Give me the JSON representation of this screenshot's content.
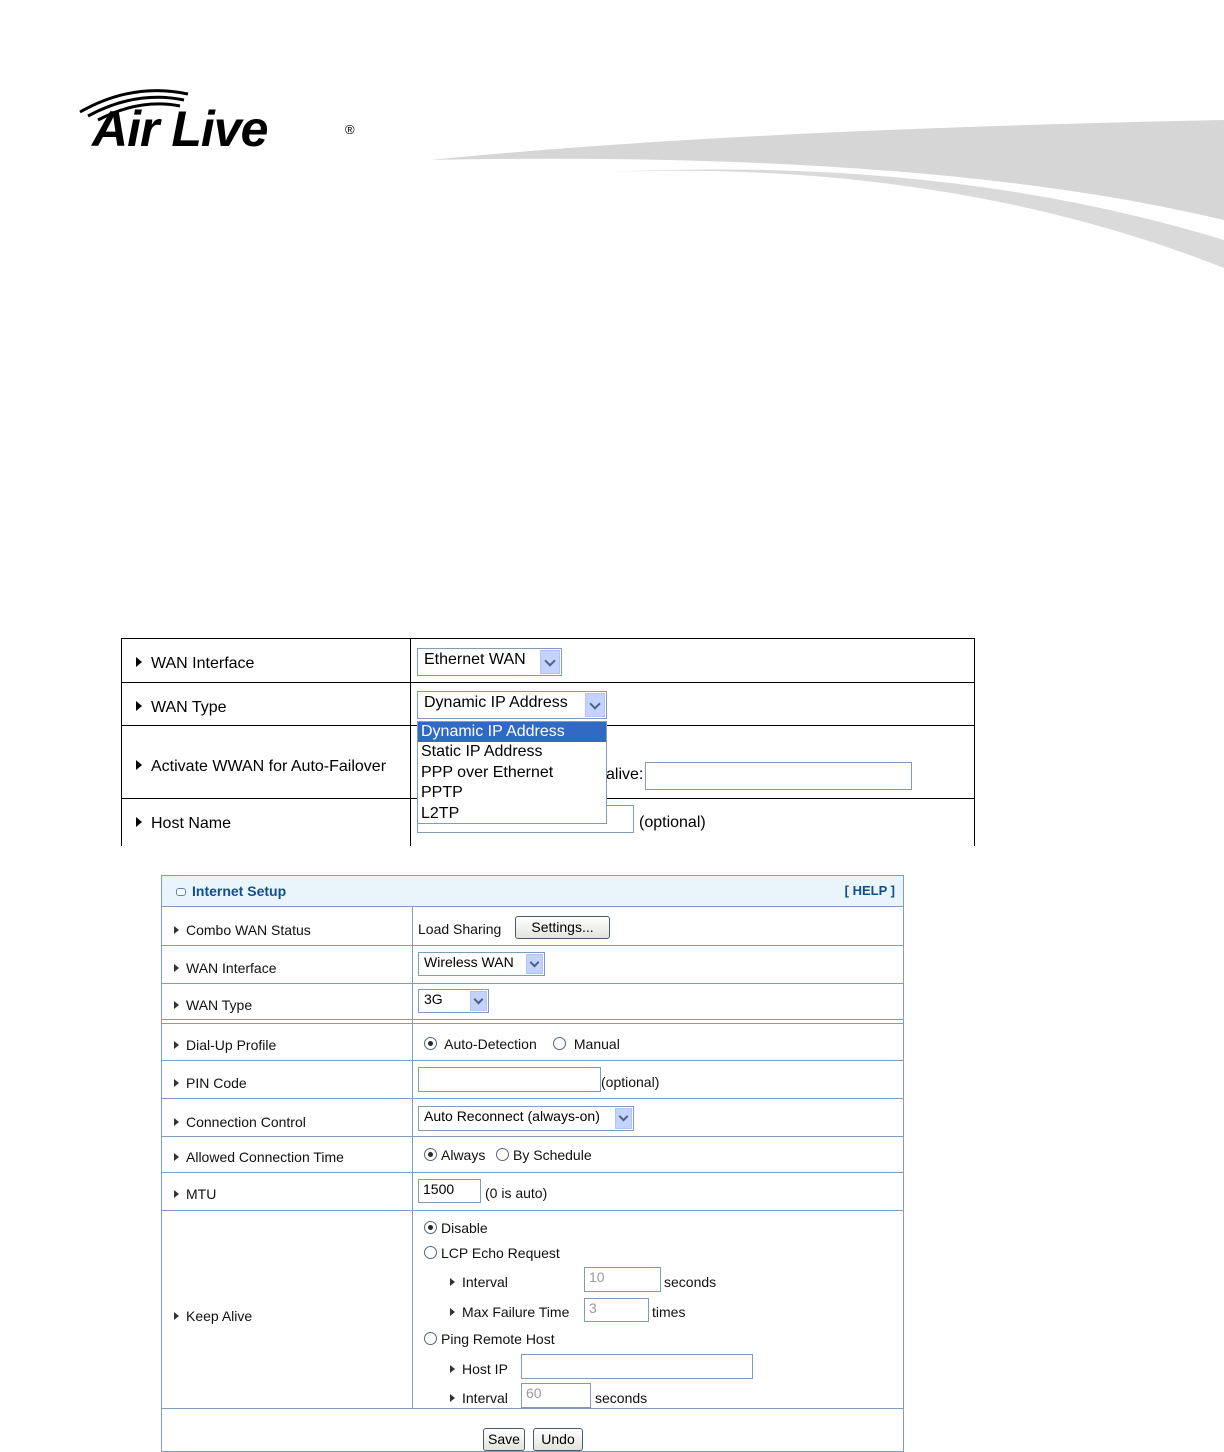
{
  "brand": {
    "logo": "Air Live",
    "registered": "®"
  },
  "table1": {
    "rows": [
      {
        "label": "WAN Interface"
      },
      {
        "label": "WAN Type"
      },
      {
        "label": "Activate WWAN for Auto-Failover"
      },
      {
        "label": "Host Name"
      }
    ],
    "wan_interface_value": "Ethernet WAN",
    "wan_type_value": "Dynamic IP Address",
    "wan_type_options": [
      "Dynamic IP Address",
      "Static IP Address",
      "PPP over Ethernet",
      "PPTP",
      "L2TP"
    ],
    "keep_alive_partial": "alive:",
    "host_name_suffix": "(optional)"
  },
  "panel": {
    "title": "Internet Setup",
    "help": "[ HELP ]",
    "combo_wan_status": {
      "label": "Combo WAN Status",
      "value": "Load Sharing",
      "button": "Settings..."
    },
    "wan_interface": {
      "label": "WAN Interface",
      "value": "Wireless WAN"
    },
    "wan_type": {
      "label": "WAN Type",
      "value": "3G"
    },
    "dialup_profile": {
      "label": "Dial-Up Profile",
      "opt1": "Auto-Detection",
      "opt2": "Manual"
    },
    "pin_code": {
      "label": "PIN Code",
      "suffix": "(optional)",
      "value": ""
    },
    "connection_control": {
      "label": "Connection Control",
      "value": "Auto Reconnect (always-on)"
    },
    "allowed_time": {
      "label": "Allowed Connection Time",
      "opt1": "Always",
      "opt2": "By Schedule"
    },
    "mtu": {
      "label": "MTU",
      "value": "1500",
      "suffix": "(0 is auto)"
    },
    "keep_alive": {
      "label": "Keep Alive",
      "opt_disable": "Disable",
      "opt_lcp": "LCP Echo Request",
      "lcp_interval_label": "Interval",
      "lcp_interval_value": "10",
      "lcp_interval_unit": "seconds",
      "max_fail_label": "Max Failure Time",
      "max_fail_value": "3",
      "max_fail_unit": "times",
      "opt_ping": "Ping Remote Host",
      "host_ip_label": "Host IP",
      "host_ip_value": "",
      "ping_interval_label": "Interval",
      "ping_interval_value": "60",
      "ping_interval_unit": "seconds"
    },
    "save": "Save",
    "undo": "Undo"
  }
}
